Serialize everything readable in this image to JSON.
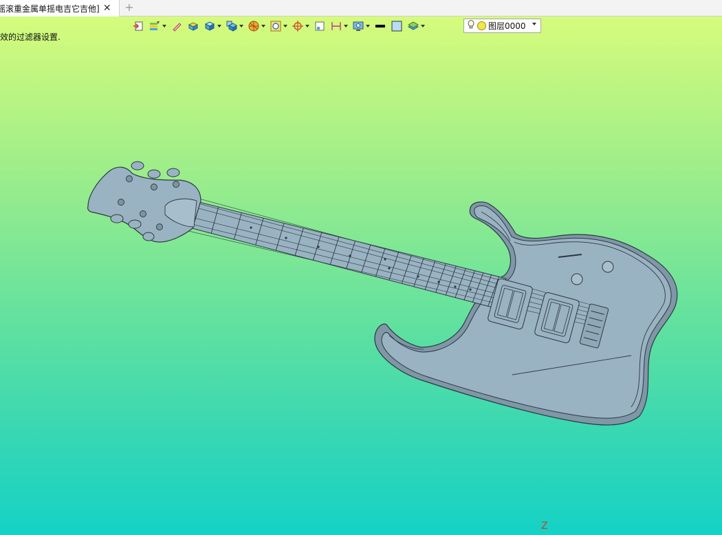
{
  "tabs": [
    {
      "label": "摇滚重金属单摇电吉它吉他]",
      "active": true
    }
  ],
  "tab_close_symbol": "✕",
  "tab_add_symbol": "+",
  "toolbar": {
    "items": [
      {
        "icon": "exit-sketch-icon",
        "dropdown": false
      },
      {
        "icon": "layer-filter-icon",
        "dropdown": true
      },
      {
        "icon": "pen-icon",
        "dropdown": false
      },
      {
        "icon": "solid-box-icon",
        "dropdown": false
      },
      {
        "icon": "cube-icon",
        "dropdown": true
      },
      {
        "icon": "cube-view-icon",
        "dropdown": true
      },
      {
        "icon": "render-mode-icon",
        "dropdown": true
      },
      {
        "icon": "zoom-fit-icon",
        "dropdown": true
      },
      {
        "icon": "snap-target-icon",
        "dropdown": true
      },
      {
        "icon": "small-box-icon",
        "dropdown": false
      },
      {
        "icon": "dimension-icon",
        "dropdown": true
      },
      {
        "icon": "display-settings-icon",
        "dropdown": true
      },
      {
        "icon": "line-color-icon",
        "dropdown": false
      },
      {
        "icon": "fill-color-icon",
        "dropdown": false
      },
      {
        "icon": "layer-stack-icon",
        "dropdown": true
      }
    ]
  },
  "layer": {
    "name": "图层0000",
    "bulb": "💡"
  },
  "prompt_text": "效的过滤器设置.",
  "axis_label": "Z",
  "colors": {
    "body_fill": "#9ab3c2",
    "outline": "#2b3740",
    "bg_top": "#dcfd7a",
    "bg_bottom": "#14d2c6"
  }
}
